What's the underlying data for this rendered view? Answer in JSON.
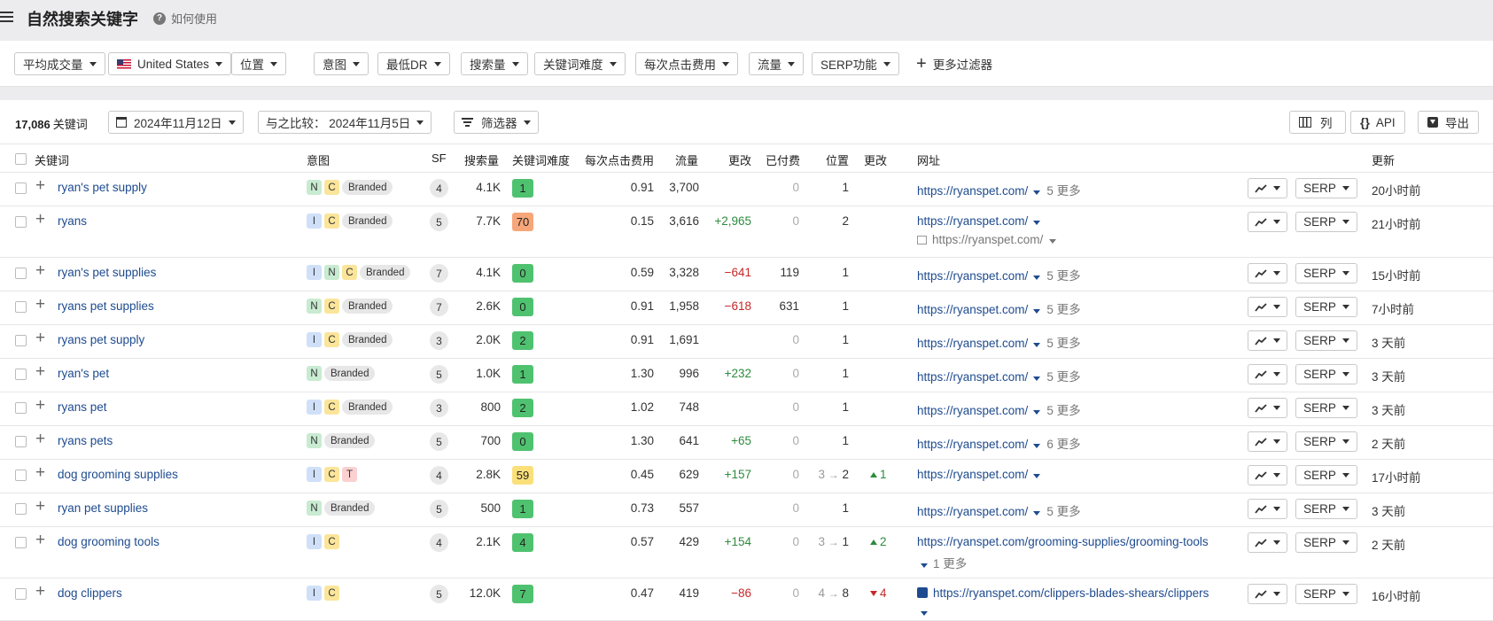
{
  "page": {
    "title": "自然搜索关键字",
    "help_label": "如何使用"
  },
  "filters": [
    {
      "label": "平均成交量"
    },
    {
      "label": "United States"
    },
    {
      "label": "位置"
    },
    {
      "label": "意图"
    },
    {
      "label": "最低DR"
    },
    {
      "label": "搜索量"
    },
    {
      "label": "关键词难度"
    },
    {
      "label": "每次点击费用"
    },
    {
      "label": "流量"
    },
    {
      "label": "SERP功能"
    }
  ],
  "more_filters_label": "更多过滤器",
  "toolbar": {
    "count": "17,086",
    "count_unit": "关键词",
    "date": "2024年11月12日",
    "compare": "与之比较： 2024年11月5日",
    "filter_label": "筛选器",
    "columns_label": "列",
    "api_label": "API",
    "export_label": "导出"
  },
  "columns": {
    "keyword": "关键词",
    "intent": "意图",
    "sf": "SF",
    "volume": "搜索量",
    "kd": "关键词难度",
    "cpc": "每次点击费用",
    "traffic": "流量",
    "change": "更改",
    "paid": "已付费",
    "position": "位置",
    "pos_change": "更改",
    "url": "网址",
    "updated": "更新"
  },
  "colors": {
    "kd_green": "#4fc26f",
    "kd_orange": "#f7a67a",
    "kd_yellow": "#fbe07a",
    "link": "#1e4b8f"
  },
  "serp_label": "SERP",
  "rows": [
    {
      "keyword": "ryan's pet supply",
      "intents": [
        "N",
        "C"
      ],
      "branded": "Branded",
      "sf": "4",
      "volume": "4.1K",
      "kd": "1",
      "cpc": "0.91",
      "traffic": "3,700",
      "change": "",
      "paid": "0",
      "position": "1",
      "url": "https://ryanspet.com/",
      "more": "5 更多",
      "updated": "20小时前"
    },
    {
      "keyword": "ryans",
      "intents": [
        "I",
        "C"
      ],
      "branded": "Branded",
      "sf": "5",
      "volume": "7.7K",
      "kd": "70",
      "cpc": "0.15",
      "traffic": "3,616",
      "change": "+2,965",
      "paid": "0",
      "position": "2",
      "url": "https://ryanspet.com/",
      "url2": "https://ryanspet.com/",
      "updated": "21小时前"
    },
    {
      "keyword": "ryan's pet supplies",
      "intents": [
        "I",
        "N",
        "C"
      ],
      "branded": "Branded",
      "sf": "7",
      "volume": "4.1K",
      "kd": "0",
      "cpc": "0.59",
      "traffic": "3,328",
      "change": "−641",
      "paid": "119",
      "position": "1",
      "url": "https://ryanspet.com/",
      "more": "5 更多",
      "updated": "15小时前"
    },
    {
      "keyword": "ryans pet supplies",
      "intents": [
        "N",
        "C"
      ],
      "branded": "Branded",
      "sf": "7",
      "volume": "2.6K",
      "kd": "0",
      "cpc": "0.91",
      "traffic": "1,958",
      "change": "−618",
      "paid": "631",
      "position": "1",
      "url": "https://ryanspet.com/",
      "more": "5 更多",
      "updated": "7小时前"
    },
    {
      "keyword": "ryans pet supply",
      "intents": [
        "I",
        "C"
      ],
      "branded": "Branded",
      "sf": "3",
      "volume": "2.0K",
      "kd": "2",
      "cpc": "0.91",
      "traffic": "1,691",
      "change": "",
      "paid": "0",
      "position": "1",
      "url": "https://ryanspet.com/",
      "more": "5 更多",
      "updated": "3 天前"
    },
    {
      "keyword": "ryan's pet",
      "intents": [
        "N"
      ],
      "branded": "Branded",
      "sf": "5",
      "volume": "1.0K",
      "kd": "1",
      "cpc": "1.30",
      "traffic": "996",
      "change": "+232",
      "paid": "0",
      "position": "1",
      "url": "https://ryanspet.com/",
      "more": "5 更多",
      "updated": "3 天前"
    },
    {
      "keyword": "ryans pet",
      "intents": [
        "I",
        "C"
      ],
      "branded": "Branded",
      "sf": "3",
      "volume": "800",
      "kd": "2",
      "cpc": "1.02",
      "traffic": "748",
      "change": "",
      "paid": "0",
      "position": "1",
      "url": "https://ryanspet.com/",
      "more": "5 更多",
      "updated": "3 天前"
    },
    {
      "keyword": "ryans pets",
      "intents": [
        "N"
      ],
      "branded": "Branded",
      "sf": "5",
      "volume": "700",
      "kd": "0",
      "cpc": "1.30",
      "traffic": "641",
      "change": "+65",
      "paid": "0",
      "position": "1",
      "url": "https://ryanspet.com/",
      "more": "6 更多",
      "updated": "2 天前"
    },
    {
      "keyword": "dog grooming supplies",
      "intents": [
        "I",
        "C",
        "T"
      ],
      "branded": "",
      "sf": "4",
      "volume": "2.8K",
      "kd": "59",
      "cpc": "0.45",
      "traffic": "629",
      "change": "+157",
      "paid": "0",
      "pos_from": "3",
      "position": "2",
      "pos_change": "1",
      "pos_dir": "up",
      "url": "https://ryanspet.com/",
      "updated": "17小时前"
    },
    {
      "keyword": "ryan pet supplies",
      "intents": [
        "N"
      ],
      "branded": "Branded",
      "sf": "5",
      "volume": "500",
      "kd": "1",
      "cpc": "0.73",
      "traffic": "557",
      "change": "",
      "paid": "0",
      "position": "1",
      "url": "https://ryanspet.com/",
      "more": "5 更多",
      "updated": "3 天前"
    },
    {
      "keyword": "dog grooming tools",
      "intents": [
        "I",
        "C"
      ],
      "branded": "",
      "sf": "4",
      "volume": "2.1K",
      "kd": "4",
      "cpc": "0.57",
      "traffic": "429",
      "change": "+154",
      "paid": "0",
      "pos_from": "3",
      "position": "1",
      "pos_change": "2",
      "pos_dir": "up",
      "url": "https://ryanspet.com/grooming-supplies/grooming-tools",
      "more2": "1 更多",
      "updated": "2 天前"
    },
    {
      "keyword": "dog clippers",
      "intents": [
        "I",
        "C"
      ],
      "branded": "",
      "sf": "5",
      "volume": "12.0K",
      "kd": "7",
      "cpc": "0.47",
      "traffic": "419",
      "change": "−86",
      "paid": "0",
      "pos_from": "4",
      "position": "8",
      "pos_change": "4",
      "pos_dir": "down",
      "url": "https://ryanspet.com/clippers-blades-shears/clippers",
      "img_url": true,
      "updated": "16小时前"
    }
  ]
}
